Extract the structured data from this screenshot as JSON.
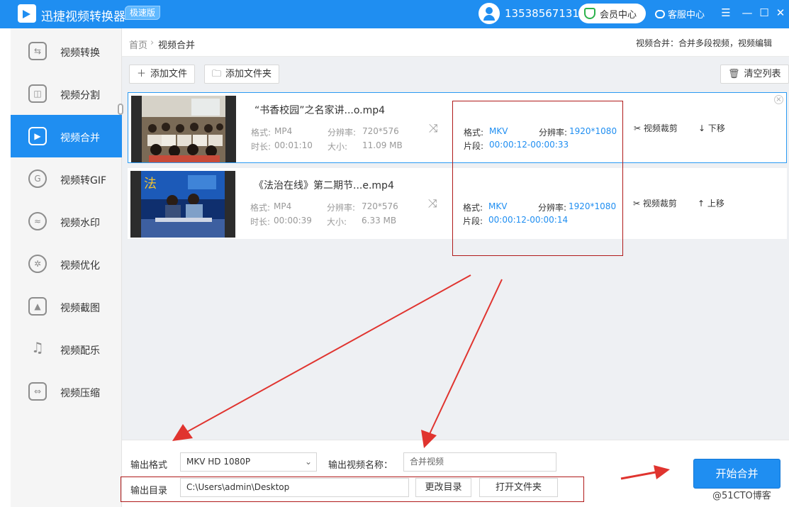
{
  "app": {
    "title": "迅捷视频转换器",
    "badge": "极速版",
    "phone": "13538567131",
    "vip_label": "会员中心",
    "service_label": "客服中心"
  },
  "window_controls": {
    "menu": "☰",
    "minimize": "—",
    "maximize": "☐",
    "close": "✕"
  },
  "sidebar": {
    "items": [
      {
        "label": "视频转换",
        "icon": "video-convert-icon",
        "glyph": "⇆",
        "active": false
      },
      {
        "label": "视频分割",
        "icon": "video-split-icon",
        "glyph": "◫",
        "active": false
      },
      {
        "label": "视频合并",
        "icon": "video-merge-icon",
        "glyph": "▶",
        "active": true
      },
      {
        "label": "视频转GIF",
        "icon": "gif-icon",
        "glyph": "G",
        "active": false
      },
      {
        "label": "视频水印",
        "icon": "watermark-icon",
        "glyph": "≈",
        "active": false
      },
      {
        "label": "视频优化",
        "icon": "film-reel-icon",
        "glyph": "✲",
        "active": false
      },
      {
        "label": "视频截图",
        "icon": "screenshot-icon",
        "glyph": "▲",
        "active": false
      },
      {
        "label": "视频配乐",
        "icon": "music-icon",
        "glyph": "♫",
        "active": false
      },
      {
        "label": "视频压缩",
        "icon": "compress-icon",
        "glyph": "⇔",
        "active": false
      }
    ]
  },
  "breadcrumb": {
    "home": "首页",
    "sep": "›",
    "page": "视频合并"
  },
  "hint": "视频合并：合并多段视频，视频编辑",
  "toolbar": {
    "add_file": "添加文件",
    "add_folder": "添加文件夹",
    "clear_list": "清空列表"
  },
  "files": [
    {
      "name": "“书香校园”之名家讲...o.mp4",
      "format_label": "格式:",
      "format": "MP4",
      "res_label": "分辨率:",
      "resolution": "720*576",
      "duration_label": "时长:",
      "duration": "00:01:10",
      "size_label": "大小:",
      "size": "11.09 MB",
      "out_format_label": "格式:",
      "out_format": "MKV",
      "out_res_label": "分辨率:",
      "out_resolution": "1920*1080",
      "segment_label": "片段:",
      "segment": "00:00:12-00:00:33",
      "crop": "视频裁剪",
      "move": "下移",
      "move_icon": "↓"
    },
    {
      "name": "《法治在线》第二期节...e.mp4",
      "format_label": "格式:",
      "format": "MP4",
      "res_label": "分辨率:",
      "resolution": "720*576",
      "duration_label": "时长:",
      "duration": "00:00:39",
      "size_label": "大小:",
      "size": "6.33 MB",
      "out_format_label": "格式:",
      "out_format": "MKV",
      "out_res_label": "分辨率:",
      "out_resolution": "1920*1080",
      "segment_label": "片段:",
      "segment": "00:00:12-00:00:14",
      "crop": "视频裁剪",
      "move": "上移",
      "move_icon": "↑"
    }
  ],
  "output": {
    "format_label": "输出格式",
    "format_value": "MKV  HD 1080P",
    "name_label": "输出视频名称：",
    "name_placeholder": "合并视频",
    "dir_label": "输出目录",
    "dir_value": "C:\\Users\\admin\\Desktop",
    "change_dir": "更改目录",
    "open_folder": "打开文件夹"
  },
  "start_button": "开始合并",
  "watermark": "@51CTO博客",
  "colors": {
    "accent": "#1f8ef1",
    "annotation": "#e0342f",
    "box": "#b01a1a"
  }
}
